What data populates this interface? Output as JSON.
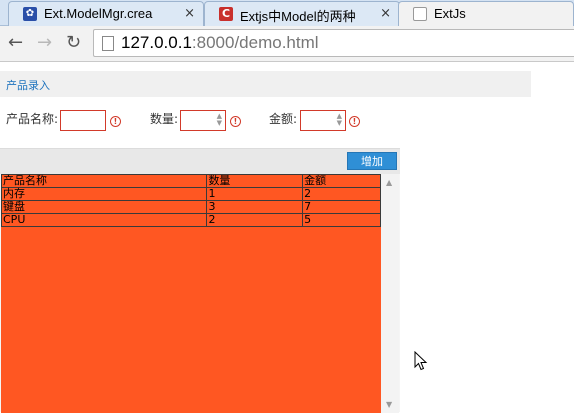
{
  "browser": {
    "tabs": [
      {
        "title": "Ext.ModelMgr.crea",
        "icon": "paw-icon",
        "active": false
      },
      {
        "title": "Extjs中Model的两种",
        "icon": "csdn-c-icon",
        "active": false
      },
      {
        "title": "ExtJs",
        "icon": "document-icon",
        "active": true
      }
    ],
    "close_glyph": "×",
    "url_host": "127.0.0.1",
    "url_rest": ":8000/demo.html"
  },
  "form": {
    "title": "产品录入",
    "fields": [
      {
        "label": "产品名称:",
        "value": ""
      },
      {
        "label": "数量:",
        "value": ""
      },
      {
        "label": "金额:",
        "value": ""
      }
    ],
    "error_glyph": "!"
  },
  "grid": {
    "add_button": "增加",
    "columns": [
      "产品名称",
      "数量",
      "金额"
    ],
    "rows": [
      [
        "内存",
        "1",
        "2"
      ],
      [
        "键盘",
        "3",
        "7"
      ],
      [
        "CPU",
        "2",
        "5"
      ]
    ],
    "background_color": "#ff5722"
  }
}
